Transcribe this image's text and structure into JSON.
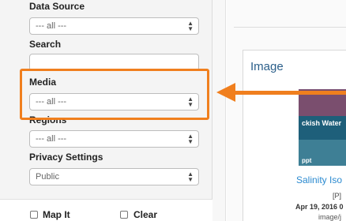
{
  "filters": {
    "data_source": {
      "label": "Data Source",
      "value": "--- all ---"
    },
    "search": {
      "label": "Search",
      "value": ""
    },
    "media": {
      "label": "Media",
      "value": "--- all ---"
    },
    "regions": {
      "label": "Regions",
      "value": "--- all ---"
    },
    "privacy": {
      "label": "Privacy Settings",
      "value": "Public"
    }
  },
  "bottom_bar": {
    "map_it": "Map It",
    "clear": "Clear"
  },
  "results": {
    "card_title": "Image",
    "thumbnail_text": "ckish Water",
    "thumbnail_text2": "ppt",
    "item_title": "Salinity Iso",
    "item_tag": "[P]",
    "item_date": "Apr 19, 2016 0",
    "item_type": "image/j"
  },
  "annotation": {
    "highlight_color": "#f07f1e"
  }
}
